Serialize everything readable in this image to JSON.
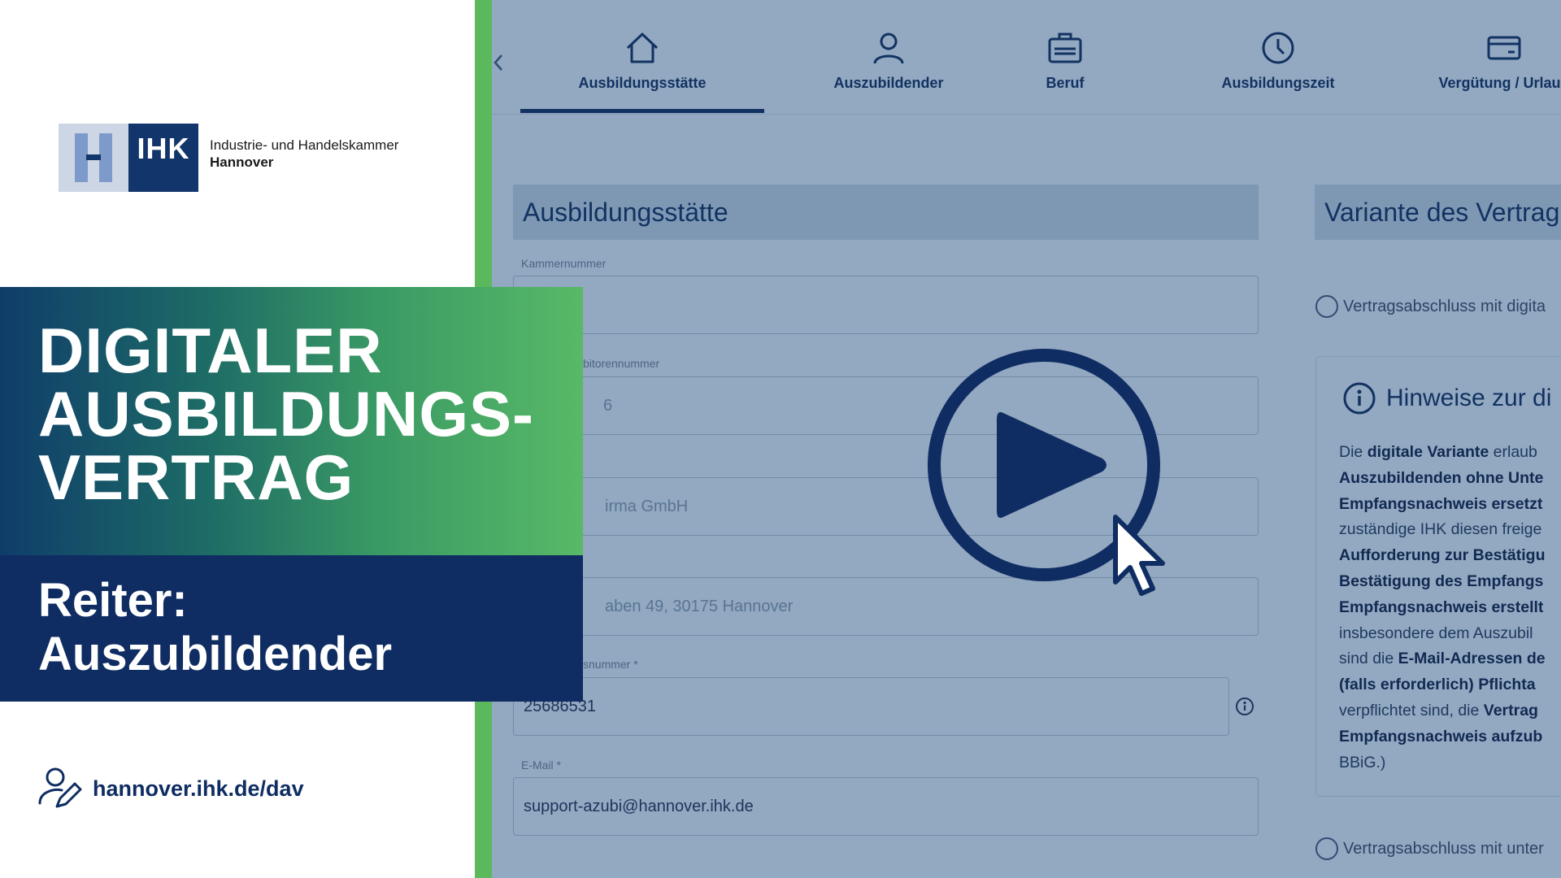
{
  "logo": {
    "badge": "IHK",
    "line1": "Industrie- und Handelskammer",
    "line2": "Hannover"
  },
  "banner": {
    "title_lines": [
      "DIGITALER",
      "AUSBILDUNGS-",
      "VERTRAG"
    ],
    "subtitle_lines": [
      "Reiter:",
      "Auszubildender"
    ]
  },
  "footer": {
    "link": "hannover.ihk.de/dav",
    "icon": "user-edit-icon"
  },
  "nav": {
    "tabs": [
      {
        "label": "Ausbildungsstätte",
        "icon": "home-icon",
        "active": true
      },
      {
        "label": "Auszubildender",
        "icon": "user-icon",
        "active": false
      },
      {
        "label": "Beruf",
        "icon": "briefcase-icon",
        "active": false
      },
      {
        "label": "Ausbildungszeit",
        "icon": "clock-icon",
        "active": false
      },
      {
        "label": "Vergütung / Urlaub",
        "icon": "card-icon",
        "active": false
      }
    ]
  },
  "form": {
    "section_title": "Ausbildungsstätte",
    "fields": [
      {
        "label": "Kammernummer",
        "value": ""
      },
      {
        "label": "bitorennummer",
        "value": "6"
      },
      {
        "label": "",
        "value": "irma GmbH"
      },
      {
        "label": "",
        "value": "aben 49, 30175 Hannover"
      },
      {
        "label": "snummer *",
        "value": "25686531"
      },
      {
        "label": "E-Mail *",
        "value": "support-azubi@hannover.ihk.de"
      }
    ]
  },
  "variant": {
    "section_title": "Variante des Vertrag",
    "option1": "Vertragsabschluss mit digita",
    "option2": "Vertragsabschluss mit unter",
    "hint_title": "Hinweise zur di",
    "hint_lines": [
      [
        {
          "t": "Die ",
          "b": false
        },
        {
          "t": "digitale Variante",
          "b": true
        },
        {
          "t": " erlaub",
          "b": false
        }
      ],
      [
        {
          "t": "Auszubildenden ohne Unte",
          "b": true
        }
      ],
      [
        {
          "t": "Empfangsnachweis ersetzt",
          "b": true
        }
      ],
      [
        {
          "t": "zuständige IHK diesen freige",
          "b": false
        }
      ],
      [
        {
          "t": "Aufforderung zur Bestätigu",
          "b": true
        }
      ],
      [
        {
          "t": "Bestätigung des Empfangs",
          "b": true
        }
      ],
      [
        {
          "t": "Empfangsnachweis erstellt",
          "b": true
        }
      ],
      [
        {
          "t": "insbesondere dem Auszubil",
          "b": false
        }
      ],
      [
        {
          "t": "sind die ",
          "b": false
        },
        {
          "t": "E-Mail-Adressen de",
          "b": true
        }
      ],
      [
        {
          "t": "(falls erforderlich) Pflichta",
          "b": true
        }
      ],
      [
        {
          "t": "verpflichtet sind, die ",
          "b": false
        },
        {
          "t": "Vertrag",
          "b": true
        }
      ],
      [
        {
          "t": "Empfangsnachweis aufzub",
          "b": true
        }
      ],
      [
        {
          "t": "BBiG.)",
          "b": false
        }
      ]
    ]
  },
  "colors": {
    "navy": "#0f2d62",
    "green": "#5cb85c",
    "overlay": "#93a8c1"
  }
}
